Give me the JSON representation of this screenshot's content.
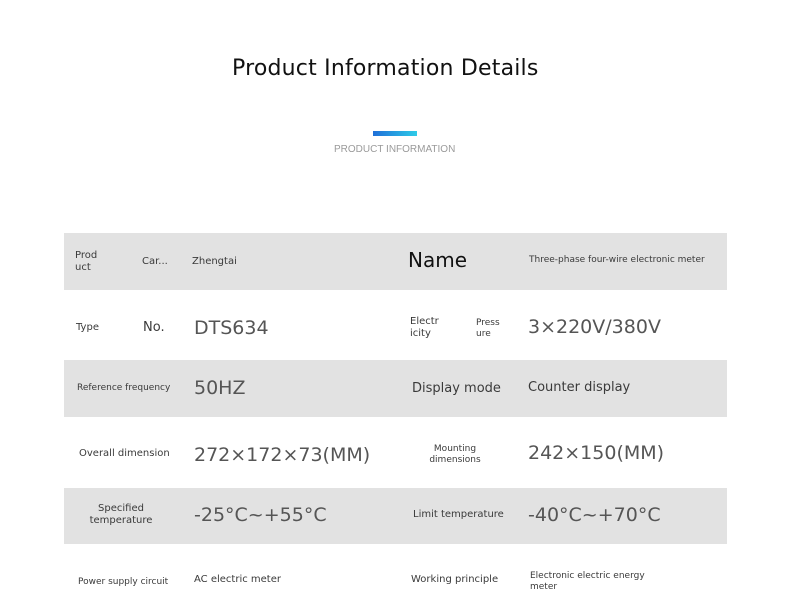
{
  "header": {
    "title": "Product Information Details",
    "subtitle": "PRODUCT INFORMATION"
  },
  "rows": {
    "r1": {
      "label_a_line1": "Prod",
      "label_a_line2": "uct",
      "label_b": "Car...",
      "value": "Zhengtai",
      "label_c": "Name",
      "value_c": "Three-phase four-wire electronic meter"
    },
    "r2": {
      "label_a": "Type",
      "label_b": "No.",
      "value": "DTS634",
      "label_c_line1": "Electr",
      "label_c_line2": "icity",
      "label_d_line1": "Press",
      "label_d_line2": "ure",
      "value_c": "3×220V/380V"
    },
    "r3": {
      "label_a": "Reference frequency",
      "value": "50HZ",
      "label_c": "Display mode",
      "value_c": "Counter display"
    },
    "r4": {
      "label_a": "Overall dimension",
      "value": "272×172×73(MM)",
      "label_c_line1": "Mounting",
      "label_c_line2": "dimensions",
      "value_c": "242×150(MM)"
    },
    "r5": {
      "label_a_line1": "Specified",
      "label_a_line2": "temperature",
      "value": "-25°C~+55°C",
      "label_c": "Limit temperature",
      "value_c": "-40°C~+70°C"
    },
    "r6": {
      "label_a": "Power supply circuit",
      "value": "AC electric meter",
      "label_c": "Working principle",
      "value_c_line1": "Electronic electric energy",
      "value_c_line2": "meter"
    }
  }
}
